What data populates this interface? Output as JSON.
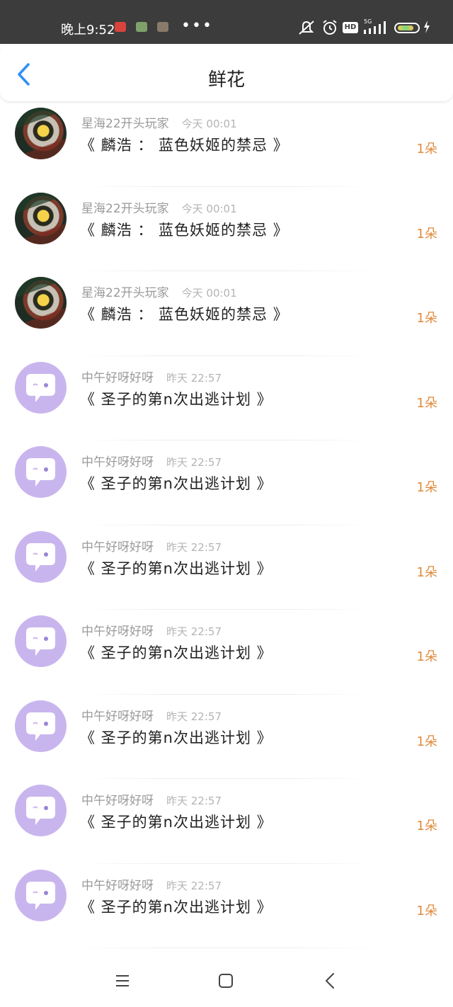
{
  "status_bar": {
    "time": "晚上9:52",
    "dots": "•••",
    "hd": "HD",
    "network": "5G",
    "icons": [
      "notification-app-icon",
      "notification-game-icon",
      "notification-avatar-icon",
      "mute-icon",
      "alarm-icon",
      "hd-icon",
      "signal-icon",
      "battery-icon",
      "charging-icon"
    ]
  },
  "header": {
    "title": "鲜花",
    "back_icon": "chevron-left-icon"
  },
  "list": [
    {
      "user": "星海22开头玩家",
      "time": "今天 00:01",
      "title": "《 麟浩 ： 蓝色妖姬的禁忌 》",
      "count": "1朵",
      "avatar": "eye-art-avatar"
    },
    {
      "user": "星海22开头玩家",
      "time": "今天 00:01",
      "title": "《 麟浩 ： 蓝色妖姬的禁忌 》",
      "count": "1朵",
      "avatar": "eye-art-avatar"
    },
    {
      "user": "星海22开头玩家",
      "time": "今天 00:01",
      "title": "《 麟浩 ： 蓝色妖姬的禁忌 》",
      "count": "1朵",
      "avatar": "eye-art-avatar"
    },
    {
      "user": "中午好呀好呀",
      "time": "昨天 22:57",
      "title": "《 圣子的第n次出逃计划 》",
      "count": "1朵",
      "avatar": "default-chat-avatar"
    },
    {
      "user": "中午好呀好呀",
      "time": "昨天 22:57",
      "title": "《 圣子的第n次出逃计划 》",
      "count": "1朵",
      "avatar": "default-chat-avatar"
    },
    {
      "user": "中午好呀好呀",
      "time": "昨天 22:57",
      "title": "《 圣子的第n次出逃计划 》",
      "count": "1朵",
      "avatar": "default-chat-avatar"
    },
    {
      "user": "中午好呀好呀",
      "time": "昨天 22:57",
      "title": "《 圣子的第n次出逃计划 》",
      "count": "1朵",
      "avatar": "default-chat-avatar"
    },
    {
      "user": "中午好呀好呀",
      "time": "昨天 22:57",
      "title": "《 圣子的第n次出逃计划 》",
      "count": "1朵",
      "avatar": "default-chat-avatar"
    },
    {
      "user": "中午好呀好呀",
      "time": "昨天 22:57",
      "title": "《 圣子的第n次出逃计划 》",
      "count": "1朵",
      "avatar": "default-chat-avatar"
    },
    {
      "user": "中午好呀好呀",
      "time": "昨天 22:57",
      "title": "《 圣子的第n次出逃计划 》",
      "count": "1朵",
      "avatar": "default-chat-avatar"
    }
  ],
  "nav_bar": {
    "icons": [
      "menu-icon",
      "home-icon",
      "back-icon"
    ]
  },
  "colors": {
    "status_bar_bg": "#3c3c3c",
    "accent_blue": "#2f8ff5",
    "count_orange": "#e08a3a",
    "avatar_purple": "#c9b5ee"
  }
}
